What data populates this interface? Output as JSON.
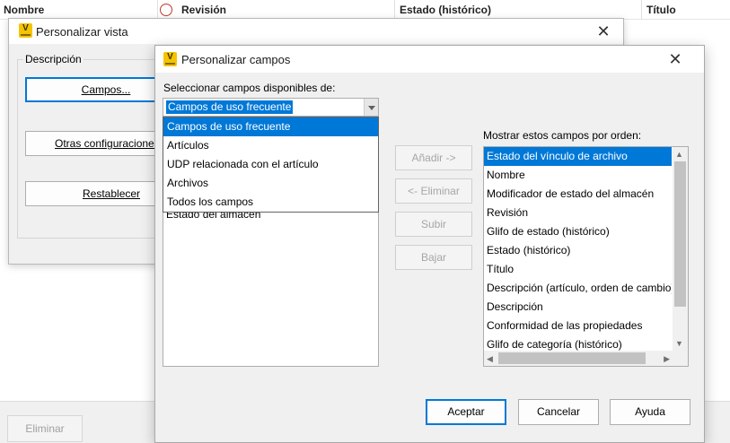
{
  "background": {
    "columns": [
      "Nombre",
      "Revisión",
      "Estado (histórico)",
      "Título"
    ],
    "delete_button": "Eliminar"
  },
  "personalizar_vista": {
    "title": "Personalizar vista",
    "group_label": "Descripción",
    "buttons": {
      "campos": "Campos...",
      "otras": "Otras configuraciones...",
      "restablecer": "Restablecer"
    },
    "close_glyph": "✕"
  },
  "personalizar_campos": {
    "title": "Personalizar campos",
    "close_glyph": "✕",
    "available_label": "Seleccionar campos disponibles de:",
    "combo_value": "Campos de uso frecuente",
    "dropdown_options": [
      "Campos de uso frecuente",
      "Artículos",
      "UDP relacionada con el artículo",
      "Archivos",
      "Todos los campos"
    ],
    "dropdown_selected_index": 0,
    "left_visible_item": "Estado del almacén",
    "mid_buttons": {
      "add": "Añadir ->",
      "remove": "<- Eliminar",
      "up": "Subir",
      "down": "Bajar"
    },
    "shown_label": "Mostrar estos campos por orden:",
    "shown_fields": [
      "Estado del vínculo de archivo",
      "Nombre",
      "Modificador de estado del almacén",
      "Revisión",
      "Glifo de estado (histórico)",
      "Estado (histórico)",
      "Título",
      "Descripción (artículo, orden de cambio)",
      "Descripción",
      "Conformidad de las propiedades",
      "Glifo de categoría (histórico)"
    ],
    "shown_selected_index": 0,
    "footer_buttons": {
      "ok": "Aceptar",
      "cancel": "Cancelar",
      "help": "Ayuda"
    },
    "accent_color": "#0078d7"
  }
}
